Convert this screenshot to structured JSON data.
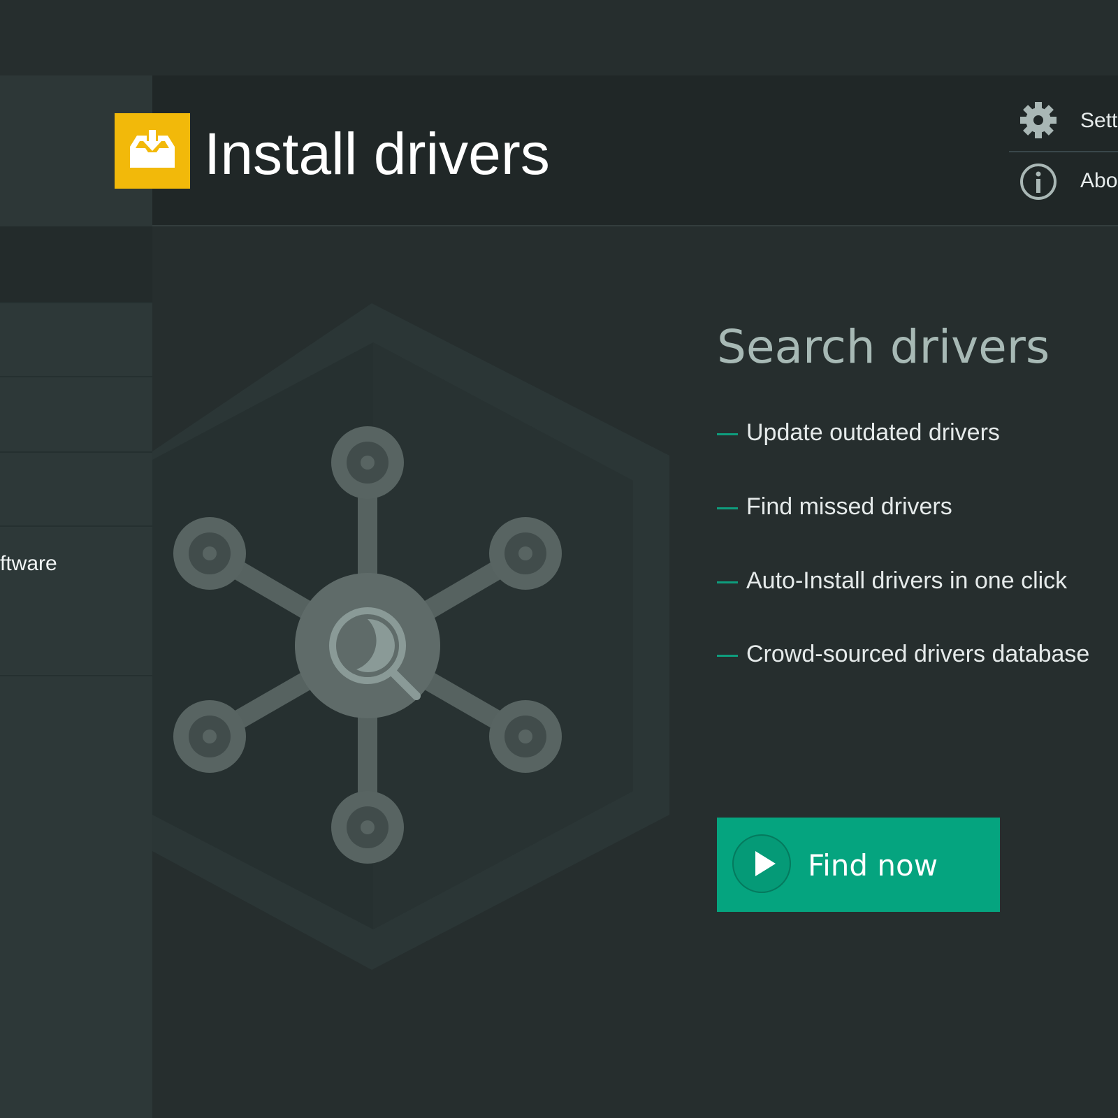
{
  "window": {
    "title": "Install drivers",
    "app_icon": "drivers-tray-download-icon",
    "accent_color": "#f2b90a"
  },
  "header_menu": {
    "settings": {
      "label": "Sett",
      "icon": "gear-icon"
    },
    "about": {
      "label": "Abo",
      "icon": "info-icon"
    }
  },
  "sidebar": {
    "items": [
      {
        "label": ""
      },
      {
        "label": ""
      },
      {
        "label": ""
      },
      {
        "label": "ftware"
      }
    ]
  },
  "main": {
    "illustration": "driver-network-hexagon-illustration",
    "heading": "Search drivers",
    "features": [
      "Update outdated drivers",
      "Find missed drivers",
      "Auto-Install drivers in one click",
      "Crowd-sourced drivers database"
    ],
    "cta": {
      "label": "Find now",
      "icon": "play-icon",
      "color": "#05a47f"
    }
  }
}
